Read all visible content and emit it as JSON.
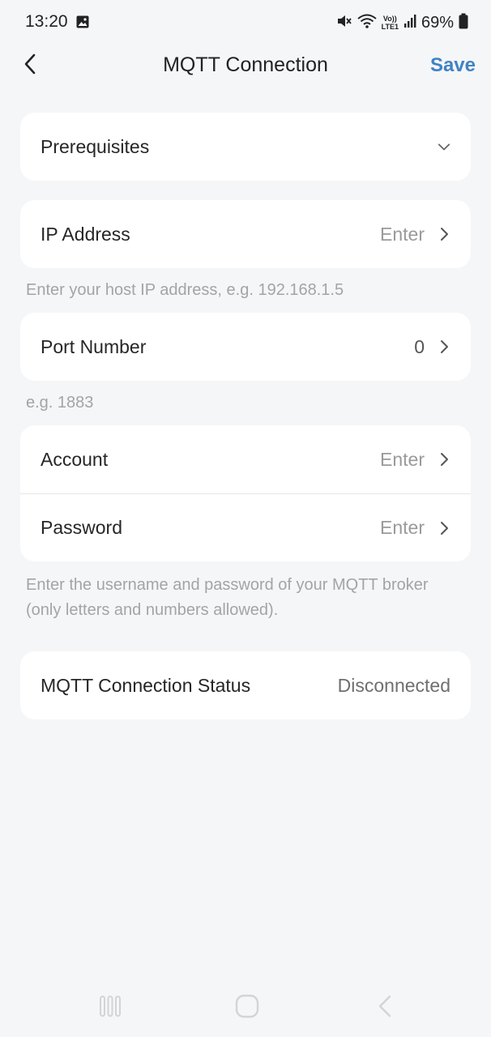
{
  "status_bar": {
    "time": "13:20",
    "battery_percent": "69%",
    "network_label_top": "Vo))",
    "network_label_bottom": "LTE1"
  },
  "header": {
    "title": "MQTT Connection",
    "save_label": "Save"
  },
  "prerequisites": {
    "label": "Prerequisites"
  },
  "ip_address": {
    "label": "IP Address",
    "value": "Enter",
    "hint": "Enter your host IP address, e.g. 192.168.1.5"
  },
  "port_number": {
    "label": "Port Number",
    "value": "0",
    "hint": "e.g. 1883"
  },
  "credentials": {
    "account_label": "Account",
    "account_value": "Enter",
    "password_label": "Password",
    "password_value": "Enter",
    "hint": "Enter the username and password of your MQTT broker (only letters and numbers allowed)."
  },
  "connection_status": {
    "label": "MQTT Connection Status",
    "value": "Disconnected"
  },
  "colors": {
    "background": "#f5f6f8",
    "card": "#ffffff",
    "accent": "#3f83c4",
    "hint_text": "#a4a4a6"
  },
  "icons": {
    "back": "chevron-left-icon",
    "row_arrow": "chevron-right-icon",
    "expand": "chevron-down-icon",
    "nav_recents": "recents-icon",
    "nav_home": "home-icon",
    "nav_back": "nav-back-icon"
  }
}
